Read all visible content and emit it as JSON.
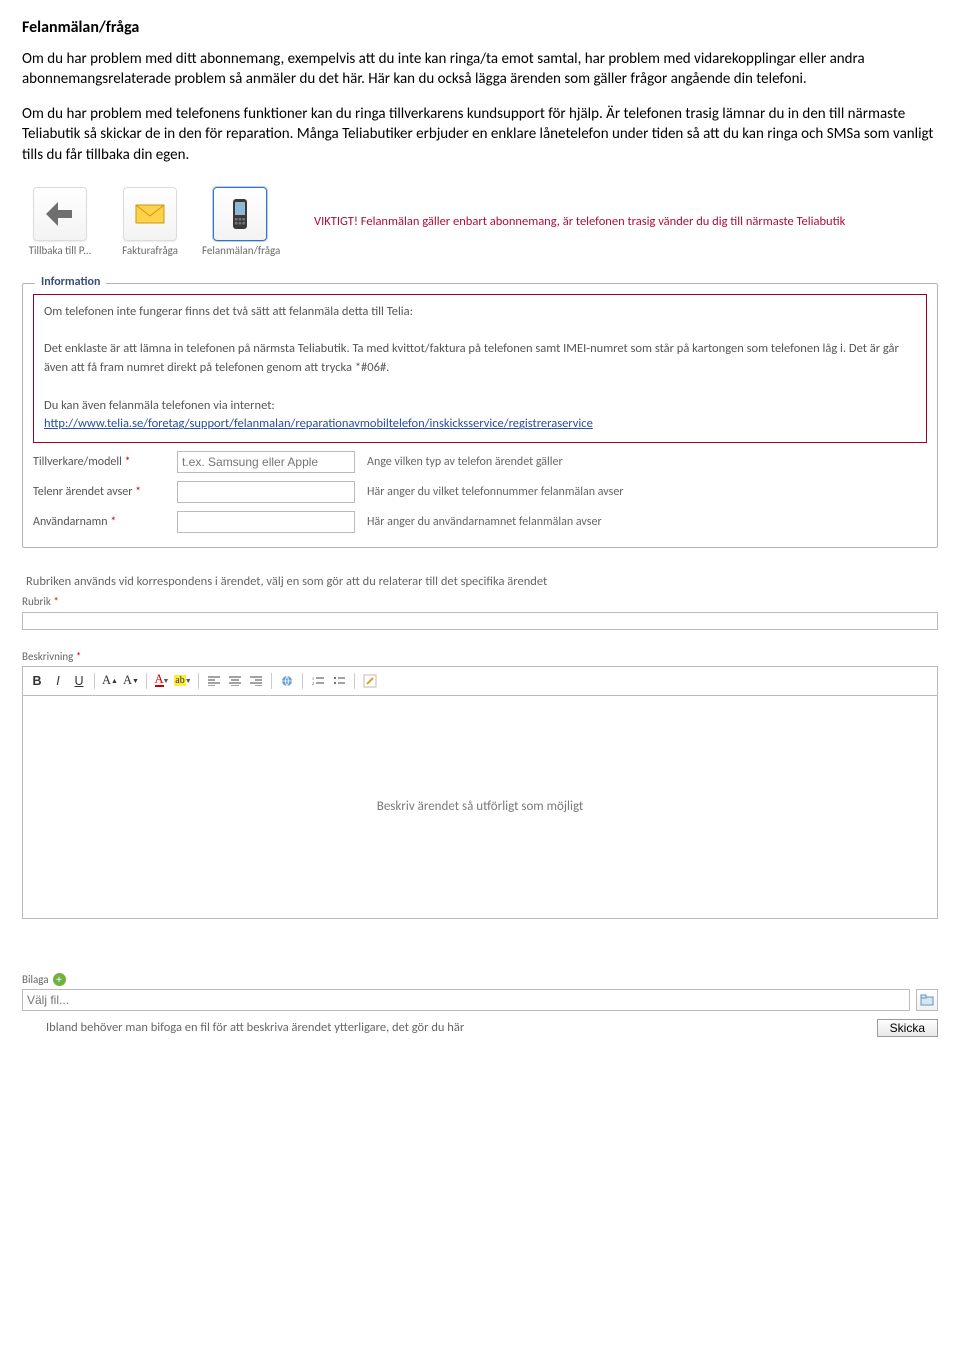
{
  "doc": {
    "heading": "Felanmälan/fråga",
    "p1": "Om du har problem med ditt abonnemang, exempelvis att du inte kan ringa/ta emot samtal, har problem med vidarekopplingar eller andra abonnemangsrelaterade problem så anmäler du det här. Här kan du också lägga ärenden som gäller frågor angående din telefoni.",
    "p2": "Om du har problem med telefonens funktioner kan du ringa tillverkarens kundsupport för hjälp. Är telefonen trasig lämnar du in den till närmaste Teliabutik så skickar de in den för reparation. Många Teliabutiker erbjuder en enklare lånetelefon under tiden så att du kan ringa och SMSa som vanligt tills du får tillbaka din egen."
  },
  "toolbar": {
    "back": "Tillbaka till P...",
    "faktura": "Fakturafråga",
    "fel": "Felanmälan/fråga",
    "important": "VIKTIGT! Felanmälan gäller enbart abonnemang, är telefonen trasig vänder du dig till närmaste Teliabutik"
  },
  "info": {
    "legend": "Information",
    "l1": "Om telefonen inte fungerar finns det två sätt att felanmäla detta till Telia:",
    "l2": "Det enklaste är att lämna in telefonen på närmsta Teliabutik. Ta med kvittot/faktura på telefonen samt IMEI-numret som står på kartongen som telefonen låg i. Det är går även att få fram numret direkt på telefonen genom att trycka *#06#.",
    "l3": "Du kan även felanmäla telefonen via internet:",
    "link": "http://www.telia.se/foretag/support/felanmalan/reparationavmobiltelefon/inskicksservice/registreraservice"
  },
  "form": {
    "f1": {
      "label": "Tillverkare/modell",
      "placeholder": "t.ex. Samsung eller Apple",
      "ann": "Ange vilken typ av telefon ärendet gäller"
    },
    "f2": {
      "label": "Telenr ärendet avser",
      "ann": "Här anger du vilket telefonnummer felanmälan avser"
    },
    "f3": {
      "label": "Användarnamn",
      "ann": "Här anger du användarnamnet felanmälan avser"
    }
  },
  "rubrik": {
    "hint": "Rubriken används vid korrespondens i ärendet, välj en som gör att du relaterar till det specifika ärendet",
    "label": "Rubrik"
  },
  "beskrivning": {
    "label": "Beskrivning",
    "placeholder": "Beskriv ärendet så utförligt som möjligt"
  },
  "bilaga": {
    "label": "Bilaga",
    "file_placeholder": "Välj fil...",
    "hint": "Ibland behöver man bifoga en fil för att beskriva ärendet ytterligare, det gör du här",
    "send": "Skicka"
  }
}
